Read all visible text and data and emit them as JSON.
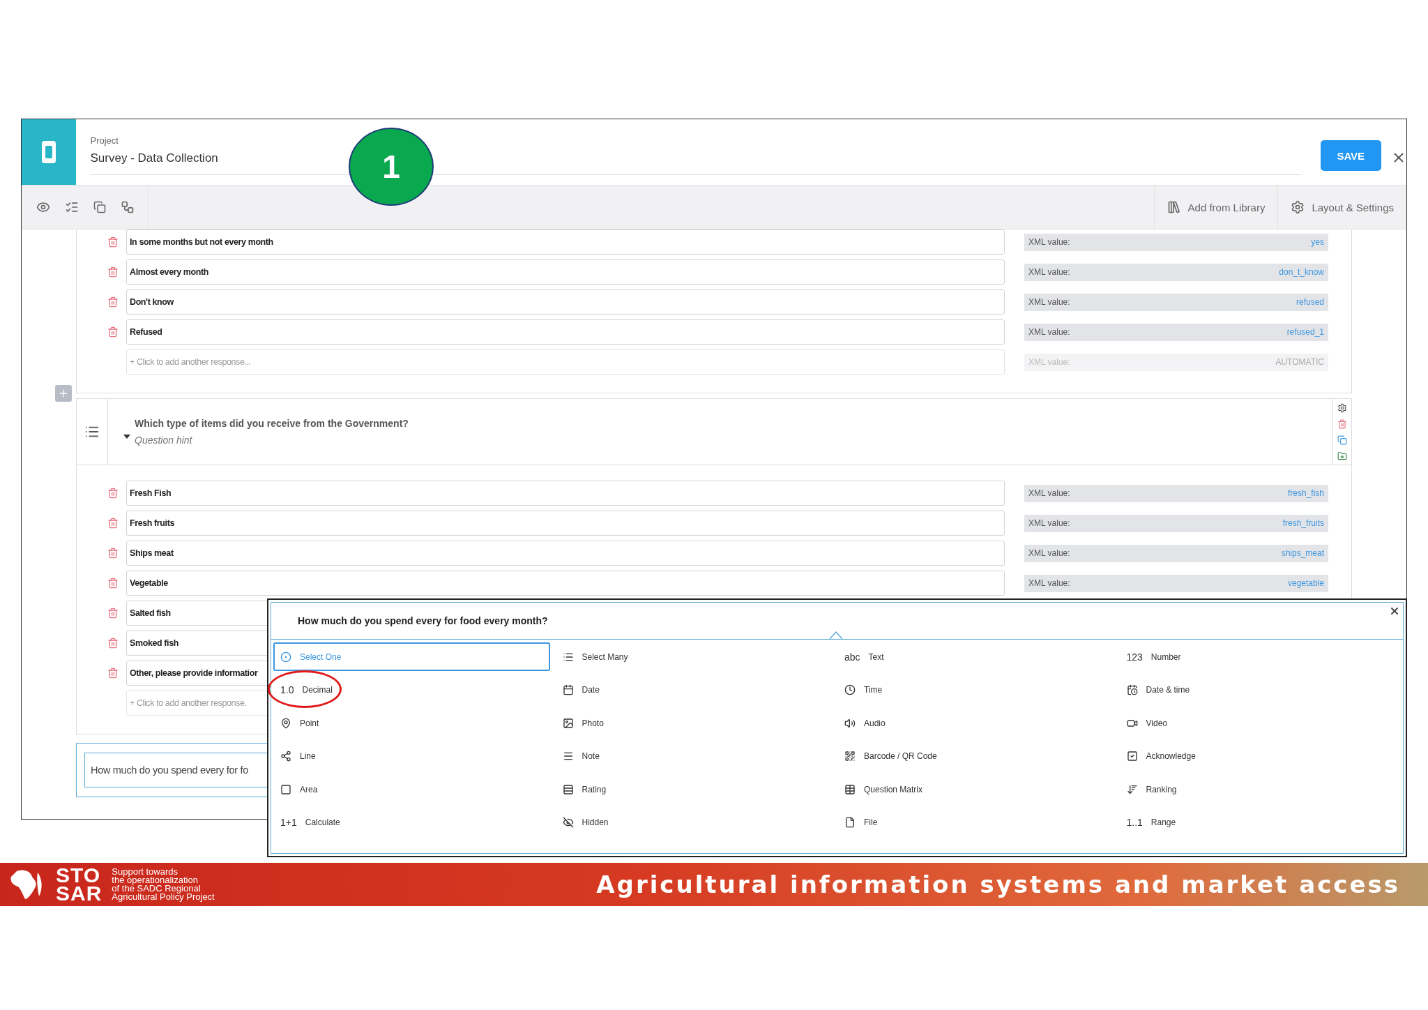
{
  "annotation": {
    "number": "1"
  },
  "header": {
    "project_label": "Project",
    "project_name": "Survey - Data Collection",
    "save": "SAVE"
  },
  "toolbar": {
    "add_from_library": "Add from Library",
    "layout_settings": "Layout & Settings"
  },
  "choices_1": [
    {
      "label": "In some months but not every month",
      "xml_label": "XML value:",
      "xml_value": "yes"
    },
    {
      "label": "Almost every  month",
      "xml_label": "XML value:",
      "xml_value": "don_t_know"
    },
    {
      "label": "Don't know",
      "xml_label": "XML value:",
      "xml_value": "refused"
    },
    {
      "label": "Refused",
      "xml_label": "XML value:",
      "xml_value": "refused_1"
    }
  ],
  "add_response_1": {
    "placeholder": "+ Click to add another response...",
    "xml_label": "XML value:",
    "xml_value": "AUTOMATIC"
  },
  "question": {
    "title": "Which type of items did you receive from the Government?",
    "hint": "Question hint",
    "expanded": true
  },
  "choices_2": [
    {
      "label": "Fresh Fish",
      "xml_label": "XML value:",
      "xml_value": "fresh_fish"
    },
    {
      "label": "Fresh fruits",
      "xml_label": "XML value:",
      "xml_value": "fresh_fruits"
    },
    {
      "label": "Ships meat",
      "xml_label": "XML value:",
      "xml_value": "ships_meat"
    },
    {
      "label": "Vegetable",
      "xml_label": "XML value:",
      "xml_value": "vegetable"
    },
    {
      "label": "Salted fish"
    },
    {
      "label": "Smoked fish"
    },
    {
      "label": "Other, please provide informatior"
    }
  ],
  "add_response_2": {
    "placeholder": "+ Click to add another response."
  },
  "new_question": {
    "value": "How much do you spend every for fo"
  },
  "type_picker": {
    "question": "How much do you spend every for food every month?",
    "types": [
      {
        "label": "Select One",
        "kind": "icon",
        "selected": true,
        "circled": false
      },
      {
        "label": "Select Many",
        "kind": "icon",
        "selected": false,
        "circled": false
      },
      {
        "label": "Text",
        "kind": "glyph",
        "glyph": "abc",
        "selected": false,
        "circled": false
      },
      {
        "label": "Number",
        "kind": "glyph",
        "glyph": "123",
        "selected": false,
        "circled": false
      },
      {
        "label": "Decimal",
        "kind": "glyph",
        "glyph": "1.0",
        "selected": false,
        "circled": true
      },
      {
        "label": "Date",
        "kind": "icon",
        "selected": false,
        "circled": false
      },
      {
        "label": "Time",
        "kind": "icon",
        "selected": false,
        "circled": false
      },
      {
        "label": "Date & time",
        "kind": "icon",
        "selected": false,
        "circled": false
      },
      {
        "label": "Point",
        "kind": "icon",
        "selected": false,
        "circled": false
      },
      {
        "label": "Photo",
        "kind": "icon",
        "selected": false,
        "circled": false
      },
      {
        "label": "Audio",
        "kind": "icon",
        "selected": false,
        "circled": false
      },
      {
        "label": "Video",
        "kind": "icon",
        "selected": false,
        "circled": false
      },
      {
        "label": "Line",
        "kind": "icon",
        "selected": false,
        "circled": false
      },
      {
        "label": "Note",
        "kind": "icon",
        "selected": false,
        "circled": false
      },
      {
        "label": "Barcode / QR Code",
        "kind": "icon",
        "selected": false,
        "circled": false
      },
      {
        "label": "Acknowledge",
        "kind": "icon",
        "selected": false,
        "circled": false
      },
      {
        "label": "Area",
        "kind": "icon",
        "selected": false,
        "circled": false
      },
      {
        "label": "Rating",
        "kind": "icon",
        "selected": false,
        "circled": false
      },
      {
        "label": "Question Matrix",
        "kind": "icon",
        "selected": false,
        "circled": false
      },
      {
        "label": "Ranking",
        "kind": "icon",
        "selected": false,
        "circled": false
      },
      {
        "label": "Calculate",
        "kind": "glyph",
        "glyph": "1+1",
        "selected": false,
        "circled": false
      },
      {
        "label": "Hidden",
        "kind": "icon",
        "selected": false,
        "circled": false
      },
      {
        "label": "File",
        "kind": "icon",
        "selected": false,
        "circled": false
      },
      {
        "label": "Range",
        "kind": "glyph",
        "glyph": "1..1",
        "selected": false,
        "circled": false
      }
    ]
  },
  "footer": {
    "logo_top": "STO",
    "logo_bottom": "SAR",
    "tagline_lines": [
      "Support towards",
      "the operationalization",
      "of the SADC Regional",
      "Agricultural Policy Project"
    ],
    "title": "Agricultural information systems and market access"
  }
}
